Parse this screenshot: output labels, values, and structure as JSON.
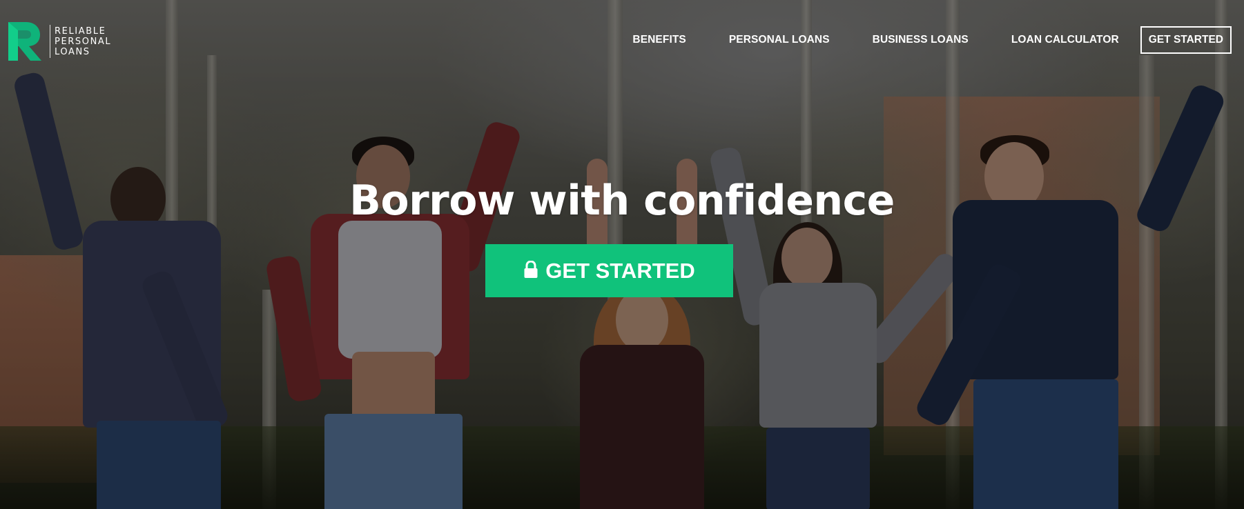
{
  "brand": {
    "logo_letter": "R",
    "logo_lines": [
      "RELIABLE",
      "PERSONAL",
      "LOANS"
    ],
    "accent_color": "#10c27b"
  },
  "nav": {
    "items": [
      {
        "label": "BENEFITS"
      },
      {
        "label": "PERSONAL LOANS"
      },
      {
        "label": "BUSINESS LOANS"
      },
      {
        "label": "LOAN CALCULATOR"
      }
    ],
    "cta_label": "GET STARTED"
  },
  "hero": {
    "headline": "Borrow with confidence",
    "cta_label": "GET STARTED",
    "cta_icon": "lock-icon",
    "cta_color": "#10c27b",
    "background": "photo-of-friends-jumping-outdoors"
  }
}
